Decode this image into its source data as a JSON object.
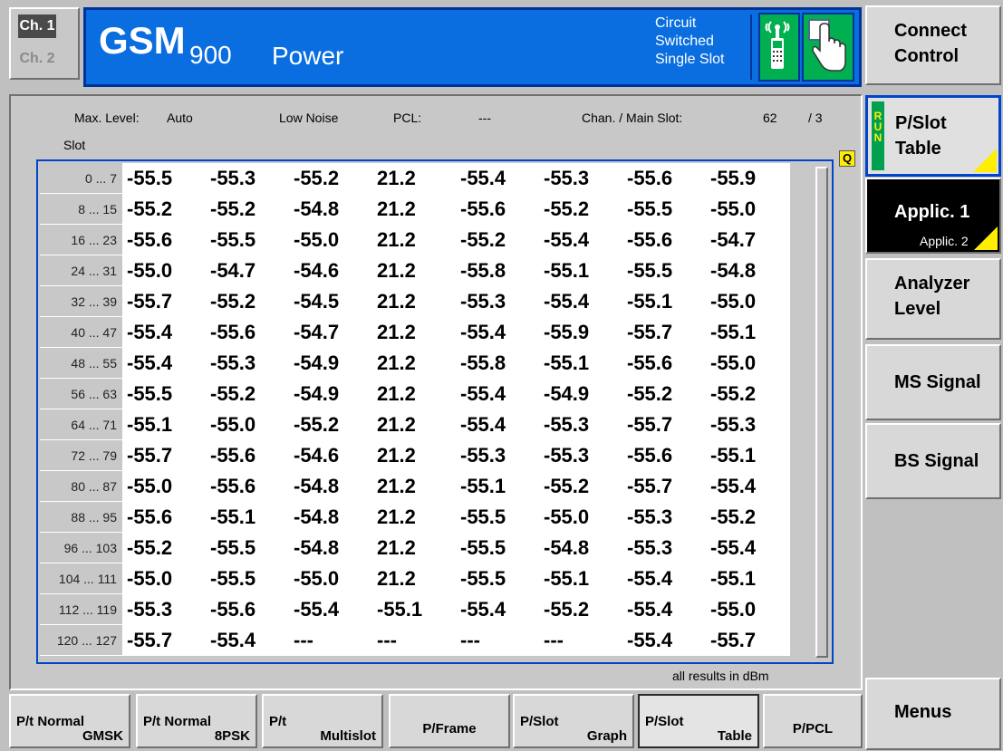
{
  "channels": {
    "ch1": "Ch. 1",
    "ch2": "Ch. 2"
  },
  "title": {
    "standard": "GSM",
    "band": "900",
    "measurement": "Power"
  },
  "status": {
    "line1": "Circuit",
    "line2": "Switched",
    "line3": "Single Slot"
  },
  "icons": {
    "ms": "mobile-signal-icon",
    "hand": "hand-pointer-icon"
  },
  "softkeys": {
    "connect_line1": "Connect",
    "connect_line2": "Control",
    "pslot_line1": "P/Slot",
    "pslot_line2": "Table",
    "run_text": "RUN",
    "applic_main": "Applic. 1",
    "applic_sub": "Applic. 2",
    "analyzer_line1": "Analyzer",
    "analyzer_line2": "Level",
    "ms_signal": "MS Signal",
    "bs_signal": "BS Signal",
    "menus": "Menus"
  },
  "info": {
    "max_level_label": "Max. Level:",
    "max_level_value": "Auto",
    "noise_mode": "Low Noise",
    "pcl_label": "PCL:",
    "pcl_value": "---",
    "chan_label": "Chan. / Main Slot:",
    "chan_value": "62",
    "slot_value": "/ 3"
  },
  "table": {
    "slot_header": "Slot",
    "q_marker": "Q",
    "units_note": "all results in dBm",
    "rows": [
      {
        "slots": "0 ...   7",
        "values": [
          "-55.5",
          "-55.3",
          "-55.2",
          "21.2",
          "-55.4",
          "-55.3",
          "-55.6",
          "-55.9"
        ]
      },
      {
        "slots": "8 ...  15",
        "values": [
          "-55.2",
          "-55.2",
          "-54.8",
          "21.2",
          "-55.6",
          "-55.2",
          "-55.5",
          "-55.0"
        ]
      },
      {
        "slots": "16 ...  23",
        "values": [
          "-55.6",
          "-55.5",
          "-55.0",
          "21.2",
          "-55.2",
          "-55.4",
          "-55.6",
          "-54.7"
        ]
      },
      {
        "slots": "24 ...  31",
        "values": [
          "-55.0",
          "-54.7",
          "-54.6",
          "21.2",
          "-55.8",
          "-55.1",
          "-55.5",
          "-54.8"
        ]
      },
      {
        "slots": "32 ...  39",
        "values": [
          "-55.7",
          "-55.2",
          "-54.5",
          "21.2",
          "-55.3",
          "-55.4",
          "-55.1",
          "-55.0"
        ]
      },
      {
        "slots": "40 ...  47",
        "values": [
          "-55.4",
          "-55.6",
          "-54.7",
          "21.2",
          "-55.4",
          "-55.9",
          "-55.7",
          "-55.1"
        ]
      },
      {
        "slots": "48 ...  55",
        "values": [
          "-55.4",
          "-55.3",
          "-54.9",
          "21.2",
          "-55.8",
          "-55.1",
          "-55.6",
          "-55.0"
        ]
      },
      {
        "slots": "56 ...  63",
        "values": [
          "-55.5",
          "-55.2",
          "-54.9",
          "21.2",
          "-55.4",
          "-54.9",
          "-55.2",
          "-55.2"
        ]
      },
      {
        "slots": "64 ...  71",
        "values": [
          "-55.1",
          "-55.0",
          "-55.2",
          "21.2",
          "-55.4",
          "-55.3",
          "-55.7",
          "-55.3"
        ]
      },
      {
        "slots": "72 ...  79",
        "values": [
          "-55.7",
          "-55.6",
          "-54.6",
          "21.2",
          "-55.3",
          "-55.3",
          "-55.6",
          "-55.1"
        ]
      },
      {
        "slots": "80 ...  87",
        "values": [
          "-55.0",
          "-55.6",
          "-54.8",
          "21.2",
          "-55.1",
          "-55.2",
          "-55.7",
          "-55.4"
        ]
      },
      {
        "slots": "88 ...  95",
        "values": [
          "-55.6",
          "-55.1",
          "-54.8",
          "21.2",
          "-55.5",
          "-55.0",
          "-55.3",
          "-55.2"
        ]
      },
      {
        "slots": "96 ... 103",
        "values": [
          "-55.2",
          "-55.5",
          "-54.8",
          "21.2",
          "-55.5",
          "-54.8",
          "-55.3",
          "-55.4"
        ]
      },
      {
        "slots": "104 ... 111",
        "values": [
          "-55.0",
          "-55.5",
          "-55.0",
          "21.2",
          "-55.5",
          "-55.1",
          "-55.4",
          "-55.1"
        ]
      },
      {
        "slots": "112 ... 119",
        "values": [
          "-55.3",
          "-55.6",
          "-55.4",
          "-55.1",
          "-55.4",
          "-55.2",
          "-55.4",
          "-55.0"
        ]
      },
      {
        "slots": "120 ... 127",
        "values": [
          "-55.7",
          "-55.4",
          "---",
          "---",
          "---",
          "---",
          "-55.4",
          "-55.7"
        ]
      }
    ]
  },
  "tabs": [
    {
      "line1": "P/t Normal",
      "line2": "GMSK"
    },
    {
      "line1": "P/t Normal",
      "line2": "8PSK"
    },
    {
      "line1": "P/t",
      "line2": "Multislot"
    },
    {
      "center": "P/Frame"
    },
    {
      "line1": "P/Slot",
      "line2": "Graph"
    },
    {
      "line1": "P/Slot",
      "line2": "Table",
      "active": true
    },
    {
      "center": "P/PCL"
    }
  ],
  "colors": {
    "title_bg": "#0a6ee0",
    "accent_blue": "#0044cc",
    "status_green": "#00b050",
    "marker_yellow": "#ffee00"
  }
}
